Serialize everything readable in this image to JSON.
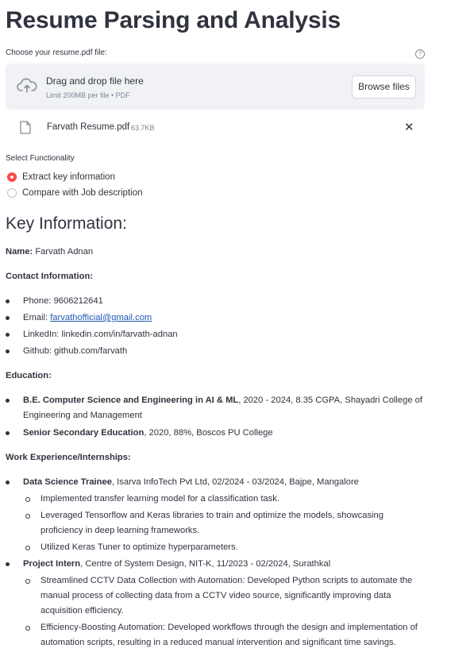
{
  "page_title": "Resume Parsing and Analysis",
  "uploader": {
    "label": "Choose your resume.pdf file:",
    "help_icon": "?",
    "drop_text": "Drag and drop file here",
    "limit_text": "Limit 200MB per file • PDF",
    "browse_label": "Browse files",
    "file_name": "Farvath Resume.pdf",
    "file_size": "63.7KB",
    "remove_icon": "✕"
  },
  "functionality": {
    "label": "Select Functionality",
    "options": [
      "Extract key information",
      "Compare with Job description"
    ],
    "selected_index": 0
  },
  "results": {
    "heading": "Key Information:",
    "name_label": "Name:",
    "name_value": "Farvath Adnan",
    "contact_heading": "Contact Information:",
    "phone": "Phone: 9606212641",
    "email_label": "Email:",
    "email_value": "farvathofficial@gmail.com",
    "linkedin": "LinkedIn: linkedin.com/in/farvath-adnan",
    "github": "Github: github.com/farvath",
    "education_heading": "Education:",
    "edu1_bold": "B.E. Computer Science and Engineering in AI & ML",
    "edu1_rest": ", 2020 - 2024, 8.35 CGPA, Shayadri College of",
    "edu1_line2": "Engineering and Management",
    "edu2_bold": "Senior Secondary Education",
    "edu2_rest": ", 2020, 88%, Boscos PU College",
    "work_heading": "Work Experience/Internships:",
    "job1_bold": "Data Science Trainee",
    "job1_rest": ", Isarva InfoTech Pvt Ltd, 02/2024 - 03/2024, Bajpe, Mangalore",
    "job1_items": [
      "Implemented transfer learning model for a classification task.",
      "Leveraged Tensorflow and Keras libraries to train and optimize the models, showcasing proficiency in deep learning frameworks.",
      "Utilized Keras Tuner to optimize hyperparameters."
    ],
    "job2_bold": "Project Intern",
    "job2_rest": ", Centre of System Design, NIT-K, 11/2023 - 02/2024, Surathkal",
    "job2_items": [
      "Streamlined CCTV Data Collection with Automation: Developed Python scripts to automate the manual process of collecting data from a CCTV video source, significantly improving data acquisition efficiency.",
      "Efficiency-Boosting Automation: Developed workflows through the design and implementation of automation scripts, resulting in a reduced manual intervention and significant time savings."
    ]
  },
  "icons": [
    "cloud-upload-icon",
    "file-icon",
    "close-icon",
    "help-icon"
  ],
  "colors": {
    "accent": "#ff4b4b",
    "text": "#31333f",
    "muted": "#808495",
    "dropzone_bg": "#f0f2f6",
    "link": "#1f57b5"
  }
}
